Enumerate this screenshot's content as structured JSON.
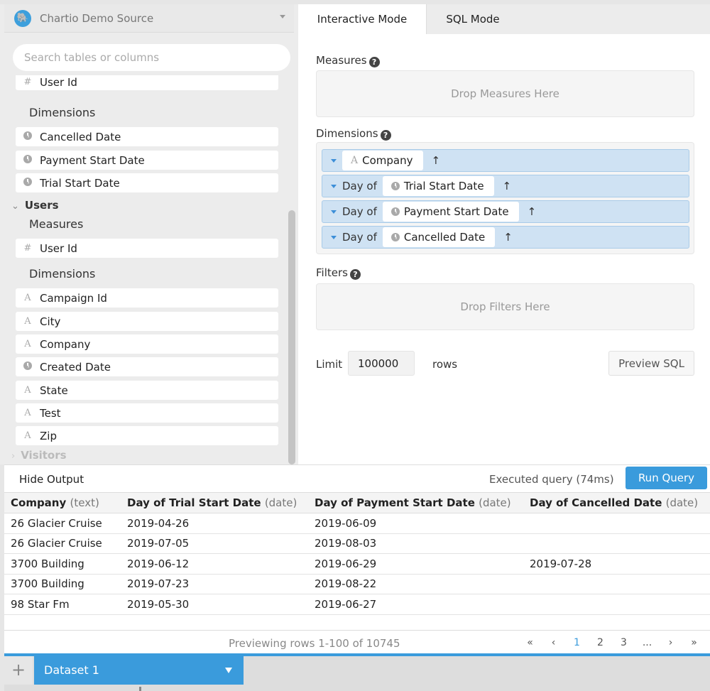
{
  "source": {
    "name": "Chartio Demo Source",
    "icon": "postgres-icon"
  },
  "search": {
    "placeholder": "Search tables or columns"
  },
  "tree": {
    "top_partial_field": "User Id",
    "prev_group": {
      "dimensions_label": "Dimensions",
      "dimensions": [
        "Cancelled Date",
        "Payment Start Date",
        "Trial Start Date"
      ]
    },
    "users_group": {
      "label": "Users",
      "measures_label": "Measures",
      "measures": [
        "User Id"
      ],
      "dimensions_label": "Dimensions",
      "dimensions": [
        {
          "name": "Campaign Id",
          "type": "text"
        },
        {
          "name": "City",
          "type": "text"
        },
        {
          "name": "Company",
          "type": "text"
        },
        {
          "name": "Created Date",
          "type": "date"
        },
        {
          "name": "State",
          "type": "text"
        },
        {
          "name": "Test",
          "type": "text"
        },
        {
          "name": "Zip",
          "type": "text"
        }
      ]
    },
    "collapsed_group": "Visitors"
  },
  "tabs": {
    "interactive": "Interactive Mode",
    "sql": "SQL Mode"
  },
  "builder": {
    "measures_title": "Measures",
    "measures_drop": "Drop Measures Here",
    "dimensions_title": "Dimensions",
    "dimensions": [
      {
        "prefix": "",
        "field": "Company",
        "type": "text",
        "sort": "↑"
      },
      {
        "prefix": "Day of",
        "field": "Trial Start Date",
        "type": "date",
        "sort": "↑"
      },
      {
        "prefix": "Day of",
        "field": "Payment Start Date",
        "type": "date",
        "sort": "↑"
      },
      {
        "prefix": "Day of",
        "field": "Cancelled Date",
        "type": "date",
        "sort": "↑"
      }
    ],
    "filters_title": "Filters",
    "filters_drop": "Drop Filters Here",
    "limit_label": "Limit",
    "limit_value": "100000",
    "rows_label": "rows",
    "preview_sql": "Preview SQL"
  },
  "output": {
    "hide_label": "Hide Output",
    "status": "Executed query (74ms)",
    "run_label": "Run Query",
    "columns": [
      {
        "name": "Company",
        "type": "(text)"
      },
      {
        "name": "Day of Trial Start Date",
        "type": "(date)"
      },
      {
        "name": "Day of Payment Start Date",
        "type": "(date)"
      },
      {
        "name": "Day of Cancelled Date",
        "type": "(date)"
      }
    ],
    "rows": [
      [
        "26 Glacier Cruise",
        "2019-04-26",
        "2019-06-09",
        ""
      ],
      [
        "26 Glacier Cruise",
        "2019-07-05",
        "2019-08-03",
        ""
      ],
      [
        "3700 Building",
        "2019-06-12",
        "2019-06-29",
        "2019-07-28"
      ],
      [
        "3700 Building",
        "2019-07-23",
        "2019-08-22",
        ""
      ],
      [
        "98 Star Fm",
        "2019-05-30",
        "2019-06-27",
        ""
      ]
    ],
    "preview_text": "Previewing rows 1-100 of 10745",
    "pager": [
      "«",
      "‹",
      "1",
      "2",
      "3",
      "...",
      "›",
      "»"
    ],
    "pager_active": "1"
  },
  "dataset": {
    "add_label": "+",
    "name": "Dataset 1"
  },
  "colors": {
    "accent": "#3a9bdc",
    "dimension_bg": "#cfe2f3",
    "panel_bg": "#ececec"
  }
}
